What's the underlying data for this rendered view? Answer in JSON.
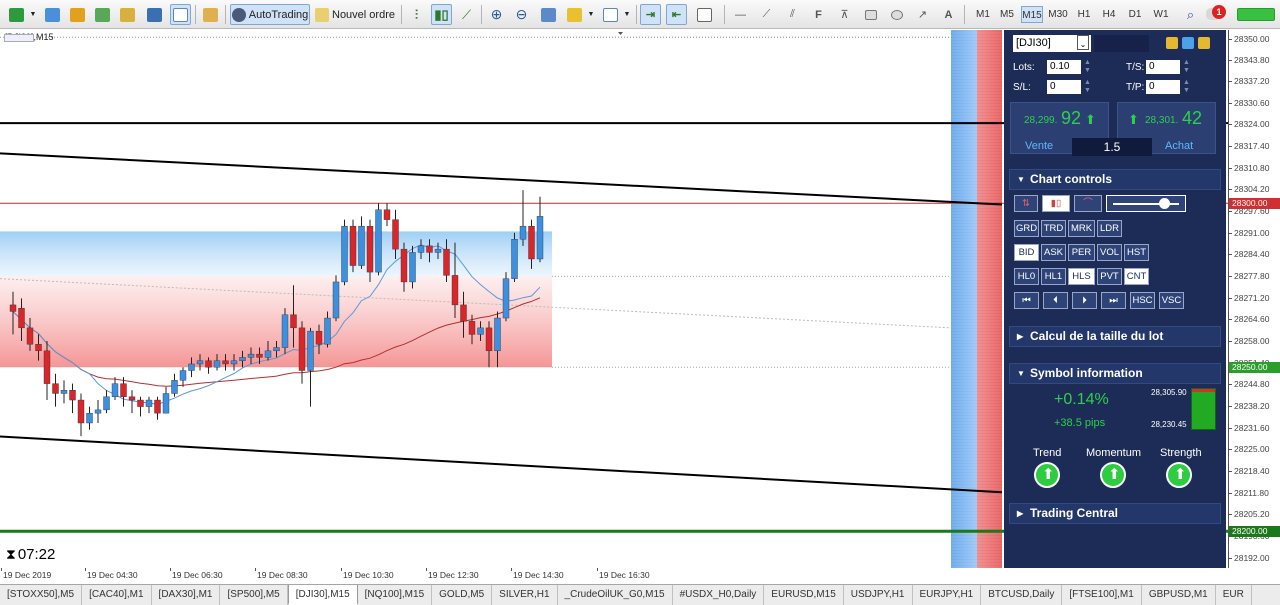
{
  "toolbar": {
    "autotrading_label": "AutoTrading",
    "new_order_label": "Nouvel ordre",
    "timeframes": [
      "M1",
      "M5",
      "M15",
      "M30",
      "H1",
      "H4",
      "D1",
      "W1"
    ],
    "active_timeframe": "M15",
    "alert_count": "1"
  },
  "chart": {
    "title": "[DJI30],M15",
    "timer": "07:22",
    "y_labels": [
      "28350.00",
      "28343.80",
      "28337.20",
      "28330.60",
      "28324.00",
      "28317.40",
      "28310.80",
      "28304.20",
      "28297.60",
      "28291.00",
      "28284.40",
      "28277.80",
      "28271.20",
      "28264.60",
      "28258.00",
      "28251.40",
      "28244.80",
      "28238.20",
      "28231.60",
      "28225.00",
      "28218.40",
      "28211.80",
      "28205.20",
      "28198.60",
      "28192.00"
    ],
    "price_tags": [
      {
        "label": "28300.00",
        "color": "#d03030"
      },
      {
        "label": "28250.00",
        "color": "#2b9e2b"
      },
      {
        "label": "28200.00",
        "color": "#1a7a1a"
      }
    ],
    "x_labels": [
      "19 Dec 2019",
      "19 Dec 04:30",
      "19 Dec 06:30",
      "19 Dec 08:30",
      "19 Dec 10:30",
      "19 Dec 12:30",
      "19 Dec 14:30",
      "19 Dec 16:30"
    ]
  },
  "chart_data": {
    "type": "candlestick",
    "symbol": "[DJI30]",
    "timeframe": "M15",
    "ylim": [
      28188.8,
      28352.8
    ],
    "candles": [
      [
        28269,
        28267,
        28260,
        28273
      ],
      [
        28268,
        28262,
        28258,
        28271
      ],
      [
        28262,
        28257,
        28255,
        28265
      ],
      [
        28257,
        28255,
        28252,
        28260
      ],
      [
        28255,
        28245,
        28240,
        28258
      ],
      [
        28245,
        28242,
        28238,
        28248
      ],
      [
        28242,
        28243,
        28239,
        28246
      ],
      [
        28243,
        28240,
        28236,
        28245
      ],
      [
        28240,
        28233,
        28229,
        28242
      ],
      [
        28233,
        28236,
        28231,
        28238
      ],
      [
        28236,
        28237,
        28233,
        28240
      ],
      [
        28237,
        28241,
        28236,
        28243
      ],
      [
        28241,
        28245,
        28240,
        28247
      ],
      [
        28245,
        28241,
        28238,
        28247
      ],
      [
        28241,
        28240,
        28236,
        28243
      ],
      [
        28240,
        28238,
        28235,
        28241
      ],
      [
        28238,
        28240,
        28236,
        28241
      ],
      [
        28240,
        28236,
        28234,
        28241
      ],
      [
        28236,
        28242,
        28236,
        28244
      ],
      [
        28242,
        28246,
        28241,
        28248
      ],
      [
        28246,
        28249,
        28244,
        28250
      ],
      [
        28249,
        28251,
        28247,
        28253
      ],
      [
        28251,
        28252,
        28249,
        28254
      ],
      [
        28252,
        28250,
        28248,
        28253
      ],
      [
        28250,
        28252,
        28249,
        28254
      ],
      [
        28252,
        28251,
        28249,
        28254
      ],
      [
        28251,
        28252,
        28249,
        28254
      ],
      [
        28252,
        28253,
        28250,
        28255
      ],
      [
        28253,
        28254,
        28251,
        28256
      ],
      [
        28254,
        28253,
        28251,
        28256
      ],
      [
        28253,
        28255,
        28252,
        28258
      ],
      [
        28255,
        28256,
        28253,
        28258
      ],
      [
        28256,
        28266,
        28254,
        28268
      ],
      [
        28266,
        28262,
        28256,
        28275
      ],
      [
        28262,
        28249,
        28245,
        28264
      ],
      [
        28249,
        28261,
        28238,
        28262
      ],
      [
        28261,
        28257,
        28254,
        28263
      ],
      [
        28257,
        28265,
        28256,
        28267
      ],
      [
        28265,
        28276,
        28264,
        28278
      ],
      [
        28276,
        28293,
        28275,
        28295
      ],
      [
        28293,
        28281,
        28279,
        28295
      ],
      [
        28281,
        28293,
        28280,
        28296
      ],
      [
        28293,
        28279,
        28276,
        28295
      ],
      [
        28279,
        28298,
        28278,
        28300
      ],
      [
        28298,
        28295,
        28293,
        28300
      ],
      [
        28295,
        28286,
        28283,
        28298
      ],
      [
        28286,
        28276,
        28273,
        28288
      ],
      [
        28276,
        28285,
        28274,
        28287
      ],
      [
        28285,
        28287,
        28283,
        28289
      ],
      [
        28287,
        28285,
        28282,
        28289
      ],
      [
        28285,
        28286,
        28283,
        28288
      ],
      [
        28286,
        28278,
        28276,
        28289
      ],
      [
        28278,
        28269,
        28265,
        28288
      ],
      [
        28269,
        28264,
        28259,
        28273
      ],
      [
        28264,
        28260,
        28257,
        28266
      ],
      [
        28260,
        28262,
        28258,
        28264
      ],
      [
        28262,
        28255,
        28250,
        28264
      ],
      [
        28255,
        28265,
        28250,
        28267
      ],
      [
        28265,
        28277,
        28264,
        28279
      ],
      [
        28277,
        28289,
        28276,
        28291
      ],
      [
        28289,
        28293,
        28287,
        28304
      ],
      [
        28293,
        28283,
        28280,
        28295
      ],
      [
        28283,
        28296,
        28282,
        28302
      ]
    ],
    "levels": [
      28324.4,
      28300.0,
      28200.0
    ],
    "zones": [
      {
        "from": 28277.7,
        "to": 28291.4,
        "color": "blue"
      },
      {
        "from": 28250.0,
        "to": 28277.7,
        "color": "red"
      }
    ]
  },
  "panel": {
    "symbol": "[DJI30]",
    "lots_label": "Lots:",
    "lots_value": "0.10",
    "sl_label": "S/L:",
    "sl_value": "0",
    "ts_label": "T/S:",
    "ts_value": "0",
    "tp_label": "T/P:",
    "tp_value": "0",
    "sell_small": "28,299.",
    "sell_big": "92",
    "buy_small": "28,301.",
    "buy_big": "42",
    "sell_label": "Vente",
    "buy_label": "Achat",
    "spread": "1.5",
    "chart_controls_title": "Chart controls",
    "controls_row1": [
      "GRD",
      "TRD",
      "MRK",
      "LDR"
    ],
    "controls_row2": [
      "BID",
      "ASK",
      "PER",
      "VOL",
      "HST"
    ],
    "controls_row3": [
      "HL0",
      "HL1",
      "HLS",
      "PVT",
      "CNT"
    ],
    "controls_row4_last": [
      "HSC",
      "VSC"
    ],
    "lot_calc_title": "Calcul de la taille du lot",
    "symbol_info_title": "Symbol information",
    "change_pct": "+0.14%",
    "change_pips": "+38.5 pips",
    "range_high": "28,305.90",
    "range_low": "28,230.45",
    "trend_label": "Trend",
    "momentum_label": "Momentum",
    "strength_label": "Strength",
    "trading_central_title": "Trading Central"
  },
  "tabs": [
    "[STOXX50],M5",
    "[CAC40],M1",
    "[DAX30],M1",
    "[SP500],M5",
    "[DJI30],M15",
    "[NQ100],M15",
    "GOLD,M5",
    "SILVER,H1",
    "_CrudeOilUK_G0,M15",
    "#USDX_H0,Daily",
    "EURUSD,M15",
    "USDJPY,H1",
    "EURJPY,H1",
    "BTCUSD,Daily",
    "[FTSE100],M1",
    "GBPUSD,M1",
    "EUR"
  ],
  "active_tab": "[DJI30],M15",
  "colors": {
    "bull": "#3d8fe0",
    "bear": "#d8262a",
    "panel_bg": "#1d2c56",
    "green_up": "#2ecc40",
    "level_green": "#1a7a1a"
  }
}
